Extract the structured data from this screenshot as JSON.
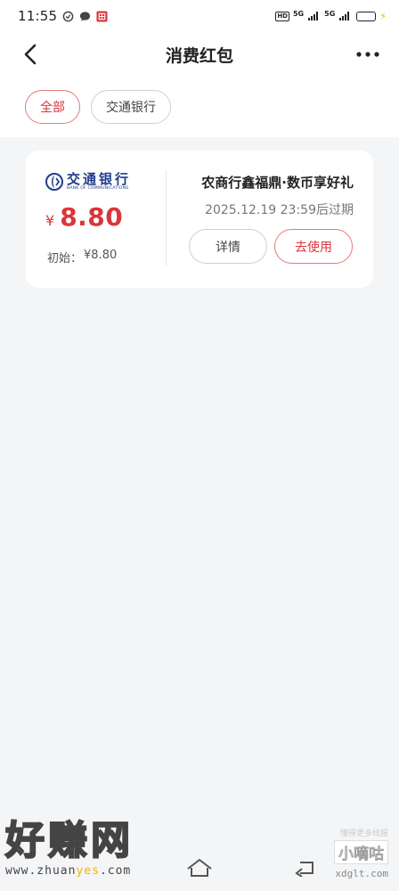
{
  "status_bar": {
    "time": "11:55",
    "hd": "HD",
    "net1": "5G",
    "net2": "5G",
    "battery_level": 1.0,
    "colors": {
      "battery": "#3ab54a",
      "bolt": "#f5b400"
    },
    "icons": [
      "settings-icon",
      "message-icon",
      "app-icon",
      "battery-icon",
      "charging-icon"
    ]
  },
  "header": {
    "title": "消费红包",
    "back_icon": "chevron-left-icon",
    "more_icon": "more-icon"
  },
  "filters": [
    {
      "label": "全部",
      "active": true
    },
    {
      "label": "交通银行",
      "active": false
    }
  ],
  "coupon": {
    "bank_name_cn": "交通银行",
    "bank_name_en": "BANK OF COMMUNICATIONS",
    "currency_symbol": "¥",
    "amount": "8.80",
    "initial_label": "初始：",
    "initial_value": "¥8.80",
    "title": "农商行鑫福鼎·数币享好礼",
    "expiry": "2025.12.19 23:59后过期",
    "detail_button": "详情",
    "use_button": "去使用"
  },
  "watermark": {
    "big_text": "好赚网",
    "url_prefix": "www.zhuan",
    "url_highlight": "yes",
    "url_suffix": ".com",
    "right_small": "懂得更多线报",
    "right_name": "小嘀咕",
    "right_site": "xdglt.com"
  },
  "nav": {
    "home_icon": "home-icon",
    "back_icon": "back-icon"
  },
  "colors": {
    "accent": "#d9363b",
    "accent_border": "#e47a7a",
    "bank_blue": "#1f3c88",
    "background": "#f4f5f7"
  }
}
